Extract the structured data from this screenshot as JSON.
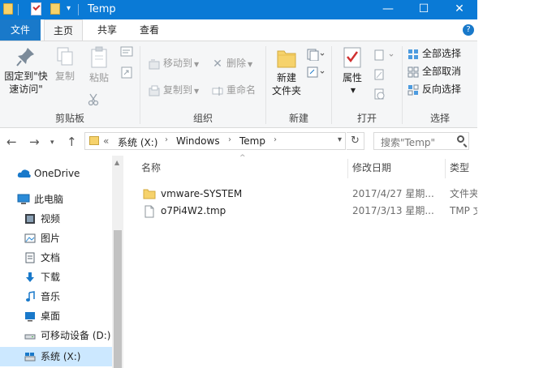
{
  "window": {
    "title": "Temp",
    "minimize": "—",
    "maximize": "☐",
    "close": "✕"
  },
  "tabs": {
    "file": "文件",
    "home": "主页",
    "share": "共享",
    "view": "查看",
    "help": "?"
  },
  "ribbon": {
    "clipboard": {
      "label": "剪贴板",
      "pin_line1": "固定到\"快",
      "pin_line2": "速访问\"",
      "copy": "复制",
      "paste": "粘贴"
    },
    "organize": {
      "label": "组织",
      "move_to": "移动到",
      "copy_to": "复制到",
      "delete": "删除",
      "rename": "重命名"
    },
    "new": {
      "label": "新建",
      "new_folder_line1": "新建",
      "new_folder_line2": "文件夹"
    },
    "open": {
      "label": "打开",
      "properties": "属性"
    },
    "select": {
      "label": "选择",
      "select_all": "全部选择",
      "select_none": "全部取消",
      "invert": "反向选择"
    }
  },
  "address": {
    "overflow": "«",
    "crumbs": [
      "系统 (X:)",
      "Windows",
      "Temp"
    ],
    "search_placeholder": "搜索\"Temp\""
  },
  "nav": {
    "items": [
      {
        "label": "OneDrive",
        "icon": "cloud-icon"
      },
      {
        "label": "此电脑",
        "icon": "computer-icon"
      },
      {
        "label": "视频",
        "icon": "video-icon"
      },
      {
        "label": "图片",
        "icon": "picture-icon"
      },
      {
        "label": "文档",
        "icon": "document-icon"
      },
      {
        "label": "下载",
        "icon": "download-icon"
      },
      {
        "label": "音乐",
        "icon": "music-icon"
      },
      {
        "label": "桌面",
        "icon": "desktop-icon"
      },
      {
        "label": "可移动设备 (D:)",
        "icon": "drive-icon"
      },
      {
        "label": "系统 (X:)",
        "icon": "windows-drive-icon"
      }
    ]
  },
  "columns": {
    "name": "名称",
    "modified": "修改日期",
    "type": "类型"
  },
  "files": [
    {
      "name": "vmware-SYSTEM",
      "date": "2017/4/27 星期...",
      "type": "文件夹",
      "icon": "folder-icon"
    },
    {
      "name": "o7Pi4W2.tmp",
      "date": "2017/3/13 星期...",
      "type": "TMP 文件",
      "icon": "file-icon"
    }
  ],
  "colors": {
    "titlebar": "#0a7ad6",
    "file_tab": "#1979ca",
    "selected": "#cce8ff",
    "ribbon_bg": "#f5f6f7"
  }
}
